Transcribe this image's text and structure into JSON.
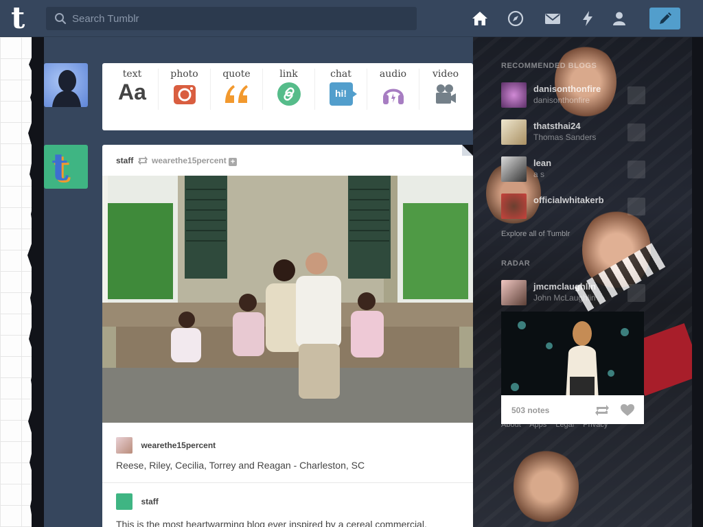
{
  "header": {
    "search_placeholder": "Search Tumblr",
    "logo_letter": "t",
    "nav_icons": [
      "home-icon",
      "explore-icon",
      "inbox-icon",
      "activity-icon",
      "account-icon"
    ],
    "compose_icon": "pencil-icon",
    "colors": {
      "bar": "#36465d",
      "compose": "#529ecc"
    }
  },
  "post_types": [
    {
      "label": "text",
      "icon": "Aa",
      "color": "#444444"
    },
    {
      "label": "photo",
      "icon": "camera-icon",
      "color": "#d95e40"
    },
    {
      "label": "quote",
      "icon": "quote-icon",
      "color": "#f2992e"
    },
    {
      "label": "link",
      "icon": "link-icon",
      "color": "#56bc8a"
    },
    {
      "label": "chat",
      "icon": "hi!",
      "color": "#529ecc"
    },
    {
      "label": "audio",
      "icon": "headphones-icon",
      "color": "#a77dc2"
    },
    {
      "label": "video",
      "icon": "video-camera-icon",
      "color": "#748089"
    }
  ],
  "post": {
    "author": "staff",
    "reblogged_from": "wearethe15percent",
    "caption_user": "wearethe15percent",
    "caption_text": "Reese, Riley, Cecilia, Torrey and Reagan - Charleston, SC",
    "comment_user": "staff",
    "comment_text": "This is the most heartwarming blog ever inspired by a cereal commercial."
  },
  "sidebar": {
    "recommended_title": "RECOMMENDED BLOGS",
    "recommended": [
      {
        "name": "danisonthonfire",
        "subtitle": "danisonthonfire"
      },
      {
        "name": "thatsthai24",
        "subtitle": "Thomas Sanders"
      },
      {
        "name": "lean",
        "subtitle": "a s"
      },
      {
        "name": "officialwhitakerb",
        "subtitle": ""
      }
    ],
    "explore": "Explore all of Tumblr",
    "radar_title": "RADAR",
    "radar": {
      "name": "jmcmclaughlin",
      "subtitle": "John McLaughlin",
      "notes": "503 notes"
    },
    "footer_links": "About Apps Legal Privacy"
  }
}
